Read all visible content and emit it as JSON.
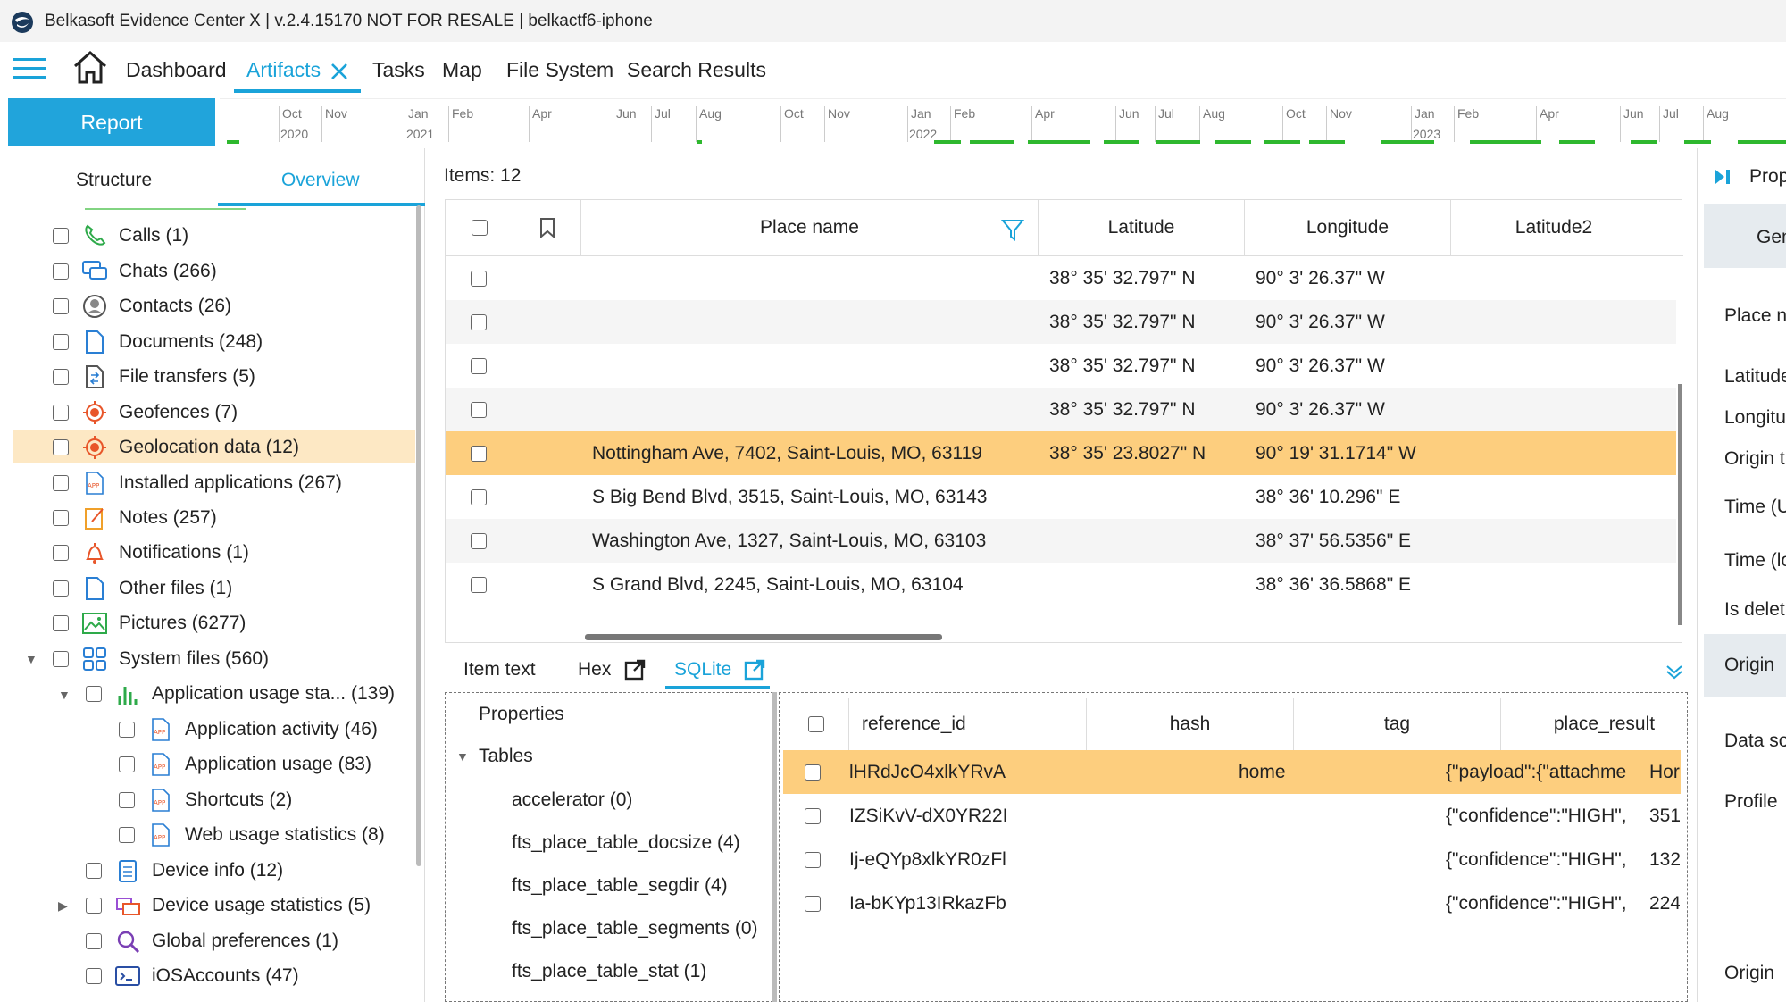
{
  "window": {
    "title": "Belkasoft Evidence Center X | v.2.4.15170 NOT FOR RESALE | belkactf6-iphone"
  },
  "nav": {
    "items": [
      "Dashboard",
      "Artifacts",
      "Tasks",
      "Map",
      "File System",
      "Search Results"
    ],
    "active": "Artifacts"
  },
  "report_button": "Report",
  "timeline": {
    "months": [
      "Oct",
      "Nov",
      "Jan",
      "Feb",
      "Apr",
      "Jun",
      "Jul",
      "Aug",
      "Oct",
      "Nov",
      "Jan",
      "Feb",
      "Apr",
      "Jun",
      "Jul",
      "Aug",
      "Oct",
      "Nov",
      "Jan",
      "Feb",
      "Apr",
      "Jun",
      "Jul",
      "Aug"
    ],
    "years": [
      "2020",
      "2021",
      "2022",
      "2023"
    ]
  },
  "left_tabs": {
    "structure": "Structure",
    "overview": "Overview"
  },
  "tree": [
    {
      "label": "Calls (1)",
      "icon": "phone-icon",
      "level": 0
    },
    {
      "label": "Chats (266)",
      "icon": "chat-icon",
      "level": 0
    },
    {
      "label": "Contacts (26)",
      "icon": "contact-icon",
      "level": 0
    },
    {
      "label": "Documents (248)",
      "icon": "document-icon",
      "level": 0
    },
    {
      "label": "File transfers (5)",
      "icon": "file-transfer-icon",
      "level": 0
    },
    {
      "label": "Geofences (7)",
      "icon": "geofence-icon",
      "level": 0
    },
    {
      "label": "Geolocation data (12)",
      "icon": "geolocation-icon",
      "level": 0,
      "selected": true
    },
    {
      "label": "Installed applications (267)",
      "icon": "app-icon",
      "level": 0
    },
    {
      "label": "Notes (257)",
      "icon": "note-icon",
      "level": 0
    },
    {
      "label": "Notifications (1)",
      "icon": "bell-icon",
      "level": 0
    },
    {
      "label": "Other files (1)",
      "icon": "file-icon",
      "level": 0
    },
    {
      "label": "Pictures (6277)",
      "icon": "picture-icon",
      "level": 0
    },
    {
      "label": "System files (560)",
      "icon": "system-files-icon",
      "level": 0,
      "expanded": true
    },
    {
      "label": "Application usage sta... (139)",
      "icon": "bar-chart-icon",
      "level": 1,
      "expanded": true
    },
    {
      "label": "Application activity (46)",
      "icon": "app-icon",
      "level": 2
    },
    {
      "label": "Application usage (83)",
      "icon": "app-icon",
      "level": 2
    },
    {
      "label": "Shortcuts (2)",
      "icon": "app-icon",
      "level": 2
    },
    {
      "label": "Web usage statistics (8)",
      "icon": "app-icon",
      "level": 2
    },
    {
      "label": "Device info (12)",
      "icon": "device-info-icon",
      "level": 1
    },
    {
      "label": "Device usage statistics (5)",
      "icon": "device-usage-icon",
      "level": 1,
      "collapsed": true
    },
    {
      "label": "Global preferences (1)",
      "icon": "magnifier-icon",
      "level": 1
    },
    {
      "label": "iOSAccounts (47)",
      "icon": "terminal-icon",
      "level": 1
    }
  ],
  "grid": {
    "items_label": "Items: 12",
    "columns": [
      "Place name",
      "Latitude",
      "Longitude",
      "Latitude2"
    ],
    "rows": [
      {
        "place": "",
        "lat": "38° 35' 32.797\" N",
        "lon": "90° 3' 26.37\" W"
      },
      {
        "place": "",
        "lat": "38° 35' 32.797\" N",
        "lon": "90° 3' 26.37\" W"
      },
      {
        "place": "",
        "lat": "38° 35' 32.797\" N",
        "lon": "90° 3' 26.37\" W"
      },
      {
        "place": "",
        "lat": "38° 35' 32.797\" N",
        "lon": "90° 3' 26.37\" W"
      },
      {
        "place": "Nottingham Ave, 7402, Saint-Louis, MO, 63119",
        "lat": "38° 35' 23.8027\" N",
        "lon": "90° 19' 31.1714\" W",
        "selected": true
      },
      {
        "place": "S Big Bend Blvd, 3515, Saint-Louis, MO, 63143",
        "lat": "",
        "lon": "38° 36' 10.296\" E"
      },
      {
        "place": "Washington Ave, 1327, Saint-Louis, MO, 63103",
        "lat": "",
        "lon": "38° 37' 56.5356\" E"
      },
      {
        "place": "S Grand Blvd, 2245, Saint-Louis, MO, 63104",
        "lat": "",
        "lon": "38° 36' 36.5868\" E"
      }
    ]
  },
  "subtabs": {
    "item_text": "Item text",
    "hex": "Hex",
    "sqlite": "SQLite"
  },
  "sqlite_tree": {
    "properties": "Properties",
    "tables": "Tables",
    "items": [
      "accelerator (0)",
      "fts_place_table_docsize (4)",
      "fts_place_table_segdir (4)",
      "fts_place_table_segments (0)",
      "fts_place_table_stat (1)"
    ]
  },
  "sqlite_grid": {
    "columns": [
      "reference_id",
      "hash",
      "tag",
      "place_result"
    ],
    "rows": [
      {
        "ref": "lHRdJcO4xlkYRvA",
        "hash": "",
        "tag": "home",
        "result": "{\"payload\":{\"attachme",
        "extra": "Hor",
        "selected": true
      },
      {
        "ref": "IZSiKvV-dX0YR22I",
        "hash": "",
        "tag": "",
        "result": "{\"confidence\":\"HIGH\",",
        "extra": "351"
      },
      {
        "ref": "Ij-eQYp8xlkYR0zFl",
        "hash": "",
        "tag": "",
        "result": "{\"confidence\":\"HIGH\",",
        "extra": "132"
      },
      {
        "ref": "Ia-bKYp13IRkazFb",
        "hash": "",
        "tag": "",
        "result": "{\"confidence\":\"HIGH\",",
        "extra": "224"
      }
    ]
  },
  "right_panel": {
    "header": "Prop",
    "general": "Genera",
    "fields": [
      "Place na",
      "Latitude",
      "Longitu",
      "Origin t",
      "Time (U",
      "Time (lo",
      "Is delet"
    ],
    "origin_band": "Origin",
    "origin_fields": [
      "Data so",
      "Profile",
      "Origin"
    ]
  },
  "colors": {
    "accent": "#1aa3d9",
    "selection": "#fdce7e",
    "tree_selection": "#fde8c4",
    "report_button": "#21a4db"
  }
}
